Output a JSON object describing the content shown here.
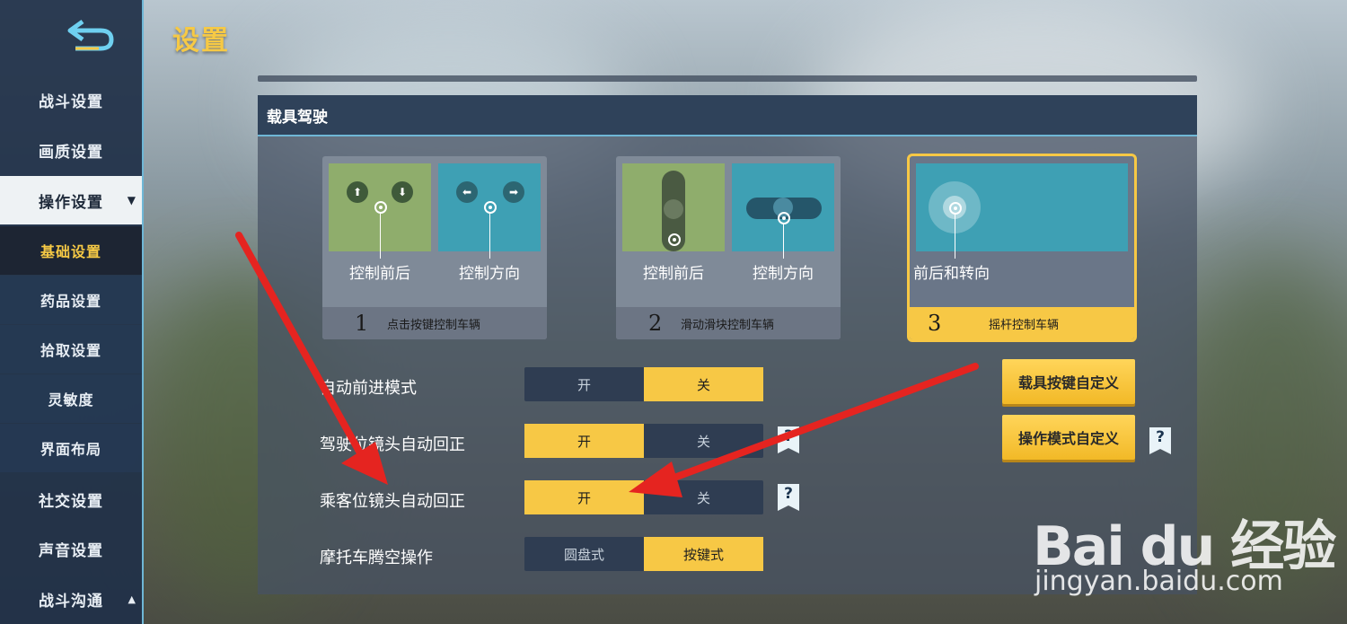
{
  "page_title": "设置",
  "sidebar": {
    "items": [
      {
        "label": "战斗设置"
      },
      {
        "label": "画质设置"
      },
      {
        "label": "操作设置",
        "caret": "▼"
      },
      {
        "label": "基础设置"
      },
      {
        "label": "药品设置"
      },
      {
        "label": "拾取设置"
      },
      {
        "label": "灵敏度"
      },
      {
        "label": "界面布局"
      },
      {
        "label": "社交设置"
      },
      {
        "label": "声音设置"
      },
      {
        "label": "战斗沟通",
        "caret": "▲"
      }
    ]
  },
  "panel": {
    "title": "载具驾驶",
    "modes": [
      {
        "number": "1",
        "title": "点击按键控制车辆",
        "left_label": "控制前后",
        "right_label": "控制方向"
      },
      {
        "number": "2",
        "title": "滑动滑块控制车辆",
        "left_label": "控制前后",
        "right_label": "控制方向"
      },
      {
        "number": "3",
        "title": "摇杆控制车辆",
        "label": "前后和转向",
        "selected": true
      }
    ],
    "rows": [
      {
        "label": "自动前进模式",
        "options": [
          "开",
          "关"
        ],
        "selected": "关"
      },
      {
        "label": "驾驶位镜头自动回正",
        "options": [
          "开",
          "关"
        ],
        "selected": "开"
      },
      {
        "label": "乘客位镜头自动回正",
        "options": [
          "开",
          "关"
        ],
        "selected": "开"
      },
      {
        "label": "摩托车腾空操作",
        "options": [
          "圆盘式",
          "按键式"
        ],
        "selected": "按键式"
      }
    ],
    "buttons": {
      "vehicle_keys": "载具按键自定义",
      "operation_mode": "操作模式自定义"
    },
    "help_symbol": "?"
  },
  "watermark": {
    "logo": "Bai du 经验",
    "url": "jingyan.baidu.com"
  },
  "colors": {
    "accent": "#f7c845",
    "sidebar_bg": "#203048",
    "annotation_arrow": "#e52420"
  }
}
